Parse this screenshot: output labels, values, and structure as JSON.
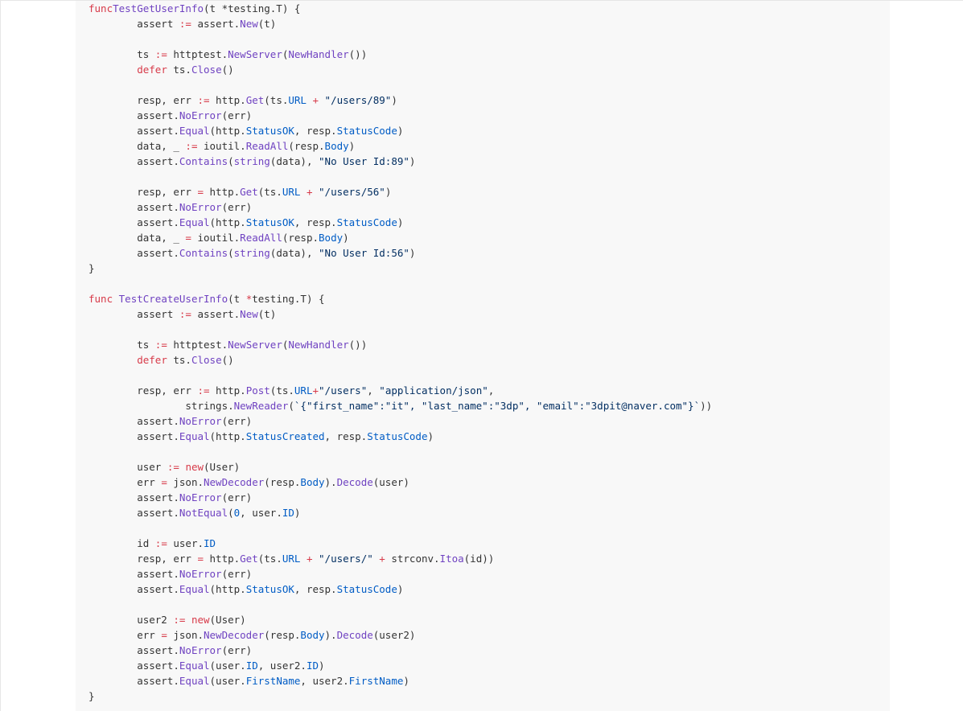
{
  "editor": {
    "language": "go",
    "colors": {
      "background": "#f8f8f8",
      "text": "#333333",
      "keyword": "#d73a49",
      "function": "#6f42c1",
      "property": "#005cc5",
      "string": "#032f62"
    },
    "lines": [
      [
        [
          "kw",
          "func"
        ],
        [
          "",
          "TestGetUserInfo",
          "fn"
        ],
        [
          "",
          "(t *testing.T) {"
        ]
      ],
      [
        [
          "",
          "        assert "
        ],
        [
          "kw",
          ":="
        ],
        [
          "",
          " assert."
        ],
        [
          "fn",
          "New"
        ],
        [
          "",
          "(t)"
        ]
      ],
      [],
      [
        [
          "",
          "        ts "
        ],
        [
          "kw",
          ":="
        ],
        [
          "",
          " httptest."
        ],
        [
          "fn",
          "NewServer"
        ],
        [
          "",
          "("
        ],
        [
          "fn",
          "NewHandler"
        ],
        [
          "",
          "())"
        ]
      ],
      [
        [
          "",
          "        "
        ],
        [
          "kw",
          "defer"
        ],
        [
          "",
          " ts."
        ],
        [
          "fn",
          "Close"
        ],
        [
          "",
          "()"
        ]
      ],
      [],
      [
        [
          "",
          "        resp, err "
        ],
        [
          "kw",
          ":="
        ],
        [
          "",
          " http."
        ],
        [
          "fn",
          "Get"
        ],
        [
          "",
          "(ts."
        ],
        [
          "pr",
          "URL"
        ],
        [
          "",
          " "
        ],
        [
          "kw",
          "+"
        ],
        [
          "",
          " "
        ],
        [
          "st",
          "\"/users/89\""
        ],
        [
          "",
          ")"
        ]
      ],
      [
        [
          "",
          "        assert."
        ],
        [
          "fn",
          "NoError"
        ],
        [
          "",
          "(err)"
        ]
      ],
      [
        [
          "",
          "        assert."
        ],
        [
          "fn",
          "Equal"
        ],
        [
          "",
          "(http."
        ],
        [
          "pr",
          "StatusOK"
        ],
        [
          "",
          ", resp."
        ],
        [
          "pr",
          "StatusCode"
        ],
        [
          "",
          ")"
        ]
      ],
      [
        [
          "",
          "        data, _ "
        ],
        [
          "kw",
          ":="
        ],
        [
          "",
          " ioutil."
        ],
        [
          "fn",
          "ReadAll"
        ],
        [
          "",
          "(resp."
        ],
        [
          "pr",
          "Body"
        ],
        [
          "",
          ")"
        ]
      ],
      [
        [
          "",
          "        assert."
        ],
        [
          "fn",
          "Contains"
        ],
        [
          "",
          "("
        ],
        [
          "fn",
          "string"
        ],
        [
          "",
          "(data), "
        ],
        [
          "st",
          "\"No User Id:89\""
        ],
        [
          "",
          ")"
        ]
      ],
      [],
      [
        [
          "",
          "        resp, err "
        ],
        [
          "kw",
          "="
        ],
        [
          "",
          " http."
        ],
        [
          "fn",
          "Get"
        ],
        [
          "",
          "(ts."
        ],
        [
          "pr",
          "URL"
        ],
        [
          "",
          " "
        ],
        [
          "kw",
          "+"
        ],
        [
          "",
          " "
        ],
        [
          "st",
          "\"/users/56\""
        ],
        [
          "",
          ")"
        ]
      ],
      [
        [
          "",
          "        assert."
        ],
        [
          "fn",
          "NoError"
        ],
        [
          "",
          "(err)"
        ]
      ],
      [
        [
          "",
          "        assert."
        ],
        [
          "fn",
          "Equal"
        ],
        [
          "",
          "(http."
        ],
        [
          "pr",
          "StatusOK"
        ],
        [
          "",
          ", resp."
        ],
        [
          "pr",
          "StatusCode"
        ],
        [
          "",
          ")"
        ]
      ],
      [
        [
          "",
          "        data, _ "
        ],
        [
          "kw",
          "="
        ],
        [
          "",
          " ioutil."
        ],
        [
          "fn",
          "ReadAll"
        ],
        [
          "",
          "(resp."
        ],
        [
          "pr",
          "Body"
        ],
        [
          "",
          ")"
        ]
      ],
      [
        [
          "",
          "        assert."
        ],
        [
          "fn",
          "Contains"
        ],
        [
          "",
          "("
        ],
        [
          "fn",
          "string"
        ],
        [
          "",
          "(data), "
        ],
        [
          "st",
          "\"No User Id:56\""
        ],
        [
          "",
          ")"
        ]
      ],
      [
        [
          "",
          "}"
        ]
      ],
      [],
      [
        [
          "kw",
          "func"
        ],
        [
          "",
          " "
        ],
        [
          "fn",
          "TestCreateUserInfo"
        ],
        [
          "",
          "(t "
        ],
        [
          "kw",
          "*"
        ],
        [
          "",
          "testing.T) {"
        ]
      ],
      [
        [
          "",
          "        assert "
        ],
        [
          "kw",
          ":="
        ],
        [
          "",
          " assert."
        ],
        [
          "fn",
          "New"
        ],
        [
          "",
          "(t)"
        ]
      ],
      [],
      [
        [
          "",
          "        ts "
        ],
        [
          "kw",
          ":="
        ],
        [
          "",
          " httptest."
        ],
        [
          "fn",
          "NewServer"
        ],
        [
          "",
          "("
        ],
        [
          "fn",
          "NewHandler"
        ],
        [
          "",
          "())"
        ]
      ],
      [
        [
          "",
          "        "
        ],
        [
          "kw",
          "defer"
        ],
        [
          "",
          " ts."
        ],
        [
          "fn",
          "Close"
        ],
        [
          "",
          "()"
        ]
      ],
      [],
      [
        [
          "",
          "        resp, err "
        ],
        [
          "kw",
          ":="
        ],
        [
          "",
          " http."
        ],
        [
          "fn",
          "Post"
        ],
        [
          "",
          "(ts."
        ],
        [
          "pr",
          "URL"
        ],
        [
          "kw",
          "+"
        ],
        [
          "st",
          "\"/users\""
        ],
        [
          "",
          ", "
        ],
        [
          "st",
          "\"application/json\""
        ],
        [
          "",
          ","
        ]
      ],
      [
        [
          "",
          "                strings."
        ],
        [
          "fn",
          "NewReader"
        ],
        [
          "",
          "("
        ],
        [
          "st",
          "`{\"first_name\":\"it\", \"last_name\":\"3dp\", \"email\":\"3dpit@naver.com\"}`"
        ],
        [
          "",
          "))"
        ]
      ],
      [
        [
          "",
          "        assert."
        ],
        [
          "fn",
          "NoError"
        ],
        [
          "",
          "(err)"
        ]
      ],
      [
        [
          "",
          "        assert."
        ],
        [
          "fn",
          "Equal"
        ],
        [
          "",
          "(http."
        ],
        [
          "pr",
          "StatusCreated"
        ],
        [
          "",
          ", resp."
        ],
        [
          "pr",
          "StatusCode"
        ],
        [
          "",
          ")"
        ]
      ],
      [],
      [
        [
          "",
          "        user "
        ],
        [
          "kw",
          ":="
        ],
        [
          "",
          " "
        ],
        [
          "kw",
          "new"
        ],
        [
          "",
          "(User)"
        ]
      ],
      [
        [
          "",
          "        err "
        ],
        [
          "kw",
          "="
        ],
        [
          "",
          " json."
        ],
        [
          "fn",
          "NewDecoder"
        ],
        [
          "",
          "(resp."
        ],
        [
          "pr",
          "Body"
        ],
        [
          "",
          ")."
        ],
        [
          "fn",
          "Decode"
        ],
        [
          "",
          "(user)"
        ]
      ],
      [
        [
          "",
          "        assert."
        ],
        [
          "fn",
          "NoError"
        ],
        [
          "",
          "(err)"
        ]
      ],
      [
        [
          "",
          "        assert."
        ],
        [
          "fn",
          "NotEqual"
        ],
        [
          "",
          "("
        ],
        [
          "pr",
          "0"
        ],
        [
          "",
          ", user."
        ],
        [
          "pr",
          "ID"
        ],
        [
          "",
          ")"
        ]
      ],
      [],
      [
        [
          "",
          "        id "
        ],
        [
          "kw",
          ":="
        ],
        [
          "",
          " user."
        ],
        [
          "pr",
          "ID"
        ]
      ],
      [
        [
          "",
          "        resp, err "
        ],
        [
          "kw",
          "="
        ],
        [
          "",
          " http."
        ],
        [
          "fn",
          "Get"
        ],
        [
          "",
          "(ts."
        ],
        [
          "pr",
          "URL"
        ],
        [
          "",
          " "
        ],
        [
          "kw",
          "+"
        ],
        [
          "",
          " "
        ],
        [
          "st",
          "\"/users/\""
        ],
        [
          "",
          " "
        ],
        [
          "kw",
          "+"
        ],
        [
          "",
          " strconv."
        ],
        [
          "fn",
          "Itoa"
        ],
        [
          "",
          "(id))"
        ]
      ],
      [
        [
          "",
          "        assert."
        ],
        [
          "fn",
          "NoError"
        ],
        [
          "",
          "(err)"
        ]
      ],
      [
        [
          "",
          "        assert."
        ],
        [
          "fn",
          "Equal"
        ],
        [
          "",
          "(http."
        ],
        [
          "pr",
          "StatusOK"
        ],
        [
          "",
          ", resp."
        ],
        [
          "pr",
          "StatusCode"
        ],
        [
          "",
          ")"
        ]
      ],
      [],
      [
        [
          "",
          "        user2 "
        ],
        [
          "kw",
          ":="
        ],
        [
          "",
          " "
        ],
        [
          "kw",
          "new"
        ],
        [
          "",
          "(User)"
        ]
      ],
      [
        [
          "",
          "        err "
        ],
        [
          "kw",
          "="
        ],
        [
          "",
          " json."
        ],
        [
          "fn",
          "NewDecoder"
        ],
        [
          "",
          "(resp."
        ],
        [
          "pr",
          "Body"
        ],
        [
          "",
          ")."
        ],
        [
          "fn",
          "Decode"
        ],
        [
          "",
          "(user2)"
        ]
      ],
      [
        [
          "",
          "        assert."
        ],
        [
          "fn",
          "NoError"
        ],
        [
          "",
          "(err)"
        ]
      ],
      [
        [
          "",
          "        assert."
        ],
        [
          "fn",
          "Equal"
        ],
        [
          "",
          "(user."
        ],
        [
          "pr",
          "ID"
        ],
        [
          "",
          ", user2."
        ],
        [
          "pr",
          "ID"
        ],
        [
          "",
          ")"
        ]
      ],
      [
        [
          "",
          "        assert."
        ],
        [
          "fn",
          "Equal"
        ],
        [
          "",
          "(user."
        ],
        [
          "pr",
          "FirstName"
        ],
        [
          "",
          ", user2."
        ],
        [
          "pr",
          "FirstName"
        ],
        [
          "",
          ")"
        ]
      ],
      [
        [
          "",
          "}"
        ]
      ]
    ]
  }
}
